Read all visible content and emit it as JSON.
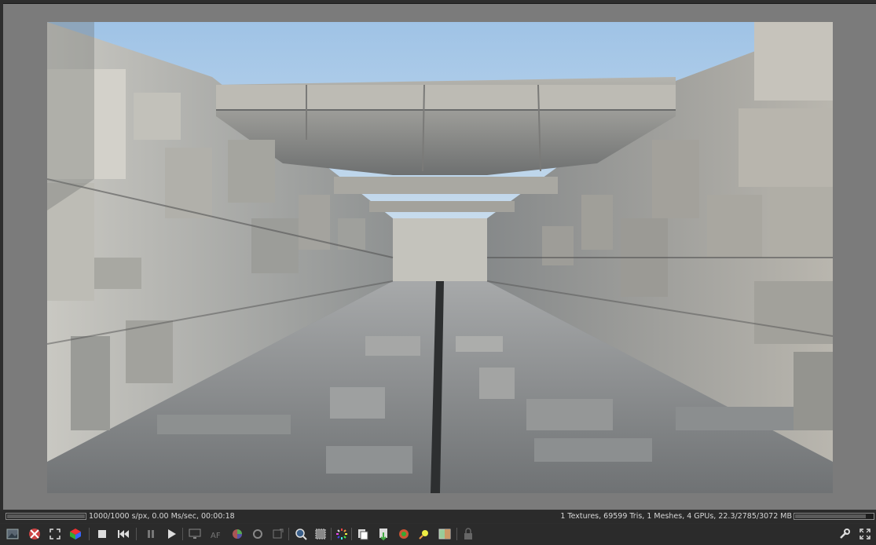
{
  "render": {
    "type": "3d-render-preview",
    "scene": "concrete-corridor"
  },
  "status": {
    "left_text": "1000/1000 s/px, 0.00 Ms/sec, 00:00:18",
    "right_text": "1 Textures, 69599 Tris, 1 Meshes, 4 GPUs, 22.3/2785/3072 MB",
    "render_progress": 1.0,
    "memory_progress": 0.91
  },
  "toolbar": {
    "icons": [
      "image-icon",
      "clear-icon",
      "fit-icon",
      "color-cube-icon",
      "stop-icon",
      "rewind-icon",
      "pause-icon",
      "play-icon",
      "monitor-icon",
      "af-icon",
      "color-wheel-icon",
      "camera-icon",
      "refresh-icon",
      "zoom-icon",
      "region-icon",
      "spinner-icon",
      "copy-icon",
      "save-icon",
      "material-icon",
      "light-icon",
      "compare-icon",
      "lock-icon",
      "settings-icon",
      "fullscreen-icon"
    ]
  },
  "colors": {
    "background": "#2b2b2b",
    "viewport": "#7b7b7b",
    "text": "#d8d8d8",
    "sky": "#a9c9e6"
  }
}
